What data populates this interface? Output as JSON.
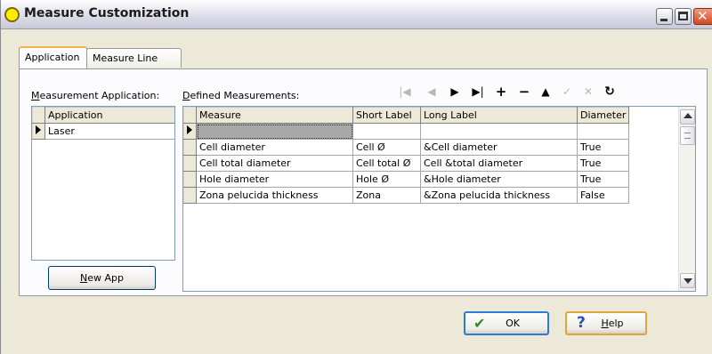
{
  "window": {
    "title": "Measure Customization"
  },
  "tabs": [
    {
      "label": "Application",
      "active": true
    },
    {
      "label": "Measure Line",
      "active": false
    }
  ],
  "app_panel": {
    "label_underline": "M",
    "label_rest": "easurement Application:",
    "column": "Application",
    "rows": [
      "Laser"
    ],
    "new_app_button": {
      "underline": "N",
      "rest": "ew App"
    }
  },
  "measure_panel": {
    "label_underline": "D",
    "label_rest": "efined Measurements:",
    "columns": [
      "Measure",
      "Short Label",
      "Long Label",
      "Diameter"
    ],
    "rows": [
      [
        "",
        "",
        "",
        ""
      ],
      [
        "Cell diameter",
        "Cell Ø",
        "&Cell diameter",
        "True"
      ],
      [
        "Cell total diameter",
        "Cell total Ø",
        "Cell &total diameter",
        "True"
      ],
      [
        "Hole diameter",
        "Hole Ø",
        "&Hole diameter",
        "True"
      ],
      [
        "Zona pelucida thickness",
        "Zona",
        "&Zona pelucida thickness",
        "False"
      ]
    ],
    "navigator": {
      "first": "|◀",
      "prior": "◀",
      "next": "▶",
      "last": "▶|",
      "insert": "+",
      "delete": "−",
      "edit": "▲",
      "post": "✓",
      "cancel": "✕",
      "refresh": "↻"
    }
  },
  "buttons": {
    "ok": "OK",
    "help_underline": "H",
    "help_rest": "elp"
  }
}
